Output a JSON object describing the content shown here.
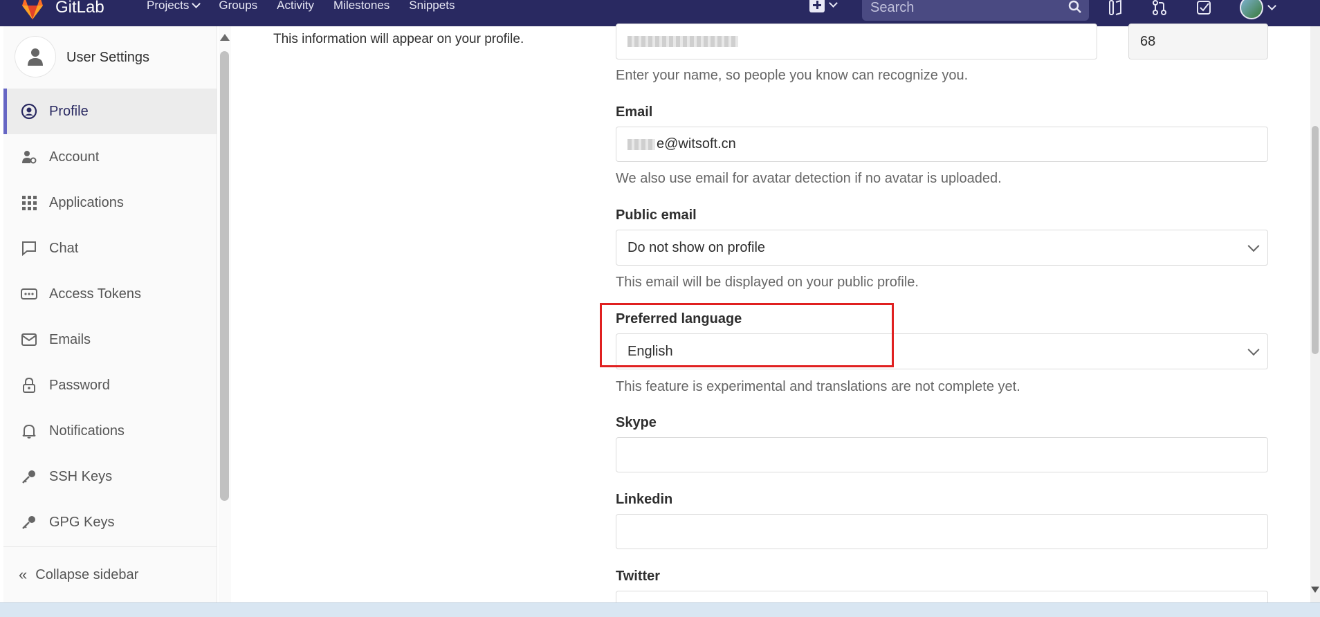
{
  "nav": {
    "brand": "GitLab",
    "links": [
      "Projects",
      "Groups",
      "Activity",
      "Milestones",
      "Snippets"
    ],
    "search_placeholder": "Search"
  },
  "sidebar": {
    "title": "User Settings",
    "items": [
      {
        "label": "Profile",
        "icon": "profile-icon",
        "active": true
      },
      {
        "label": "Account",
        "icon": "account-icon"
      },
      {
        "label": "Applications",
        "icon": "applications-icon"
      },
      {
        "label": "Chat",
        "icon": "chat-icon"
      },
      {
        "label": "Access Tokens",
        "icon": "token-icon"
      },
      {
        "label": "Emails",
        "icon": "mail-icon"
      },
      {
        "label": "Password",
        "icon": "lock-icon"
      },
      {
        "label": "Notifications",
        "icon": "bell-icon"
      },
      {
        "label": "SSH Keys",
        "icon": "key-icon"
      },
      {
        "label": "GPG Keys",
        "icon": "key-icon"
      }
    ],
    "collapse_label": "Collapse sidebar"
  },
  "main": {
    "info_text": "This information will appear on your profile.",
    "name_help": "Enter your name, so people you know can recognize you.",
    "id_value": "68",
    "email_label": "Email",
    "email_value": "e@witsoft.cn",
    "email_help": "We also use email for avatar detection if no avatar is uploaded.",
    "public_email_label": "Public email",
    "public_email_value": "Do not show on profile",
    "public_email_help": "This email will be displayed on your public profile.",
    "language_label": "Preferred language",
    "language_value": "English",
    "language_help": "This feature is experimental and translations are not complete yet.",
    "skype_label": "Skype",
    "linkedin_label": "Linkedin",
    "twitter_label": "Twitter"
  },
  "colors": {
    "navbar": "#292961",
    "highlight": "#e02020",
    "active_border": "#6666c4"
  }
}
